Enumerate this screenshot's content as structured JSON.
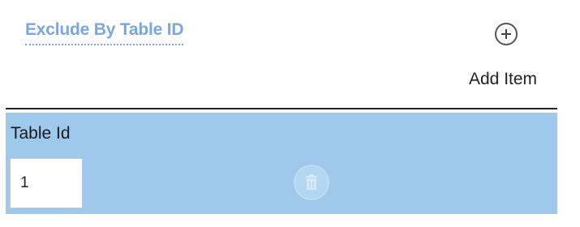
{
  "section": {
    "title": "Exclude By Table ID"
  },
  "actions": {
    "add_icon": "plus-circle-icon",
    "add_label": "Add Item"
  },
  "items": [
    {
      "field_label": "Table Id",
      "value": "1",
      "delete_icon": "trash-icon"
    }
  ],
  "colors": {
    "title": "#7aa7e0",
    "row_background": "#9ec8ec",
    "divider": "#222222"
  }
}
